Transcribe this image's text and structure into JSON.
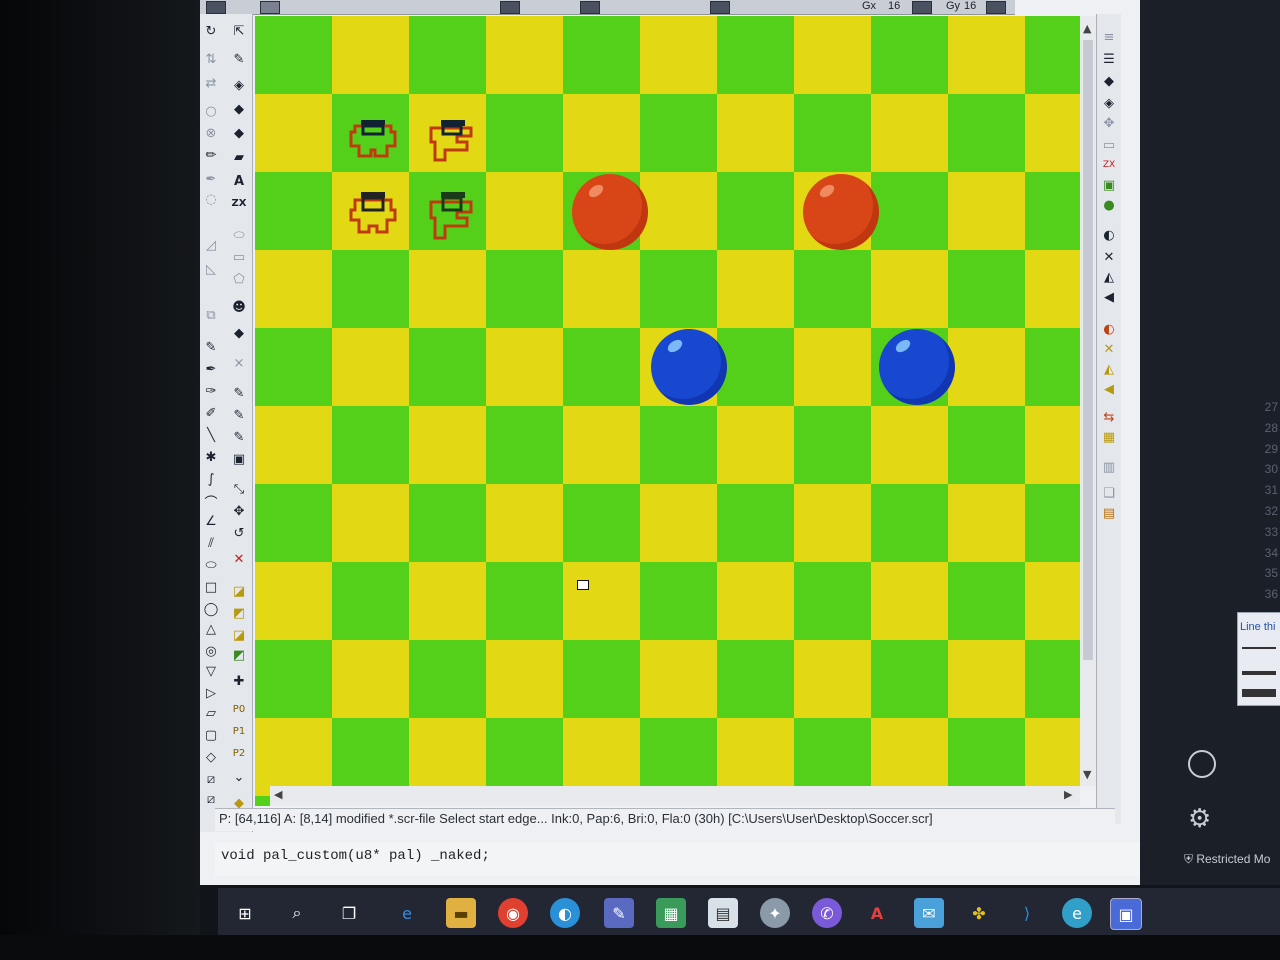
{
  "window": {
    "menubar": {
      "gx_label": "Gx",
      "gx_value": "16",
      "gy_label": "Gy",
      "gy_value": "16"
    }
  },
  "left_toolbar": {
    "text_tool_label": "A",
    "zx_label": "ZX",
    "page_buttons": [
      "P0",
      "P1",
      "P2"
    ]
  },
  "board": {
    "colors": {
      "yellow": "#e2d814",
      "green": "#55d01a",
      "red_ball": "#d84618",
      "blue_ball": "#1848d0"
    }
  },
  "status": {
    "text": "P: [64,116] A: [8,14] modified *.scr-file Select start edge... Ink:0, Pap:6, Bri:0, Fla:0 (30h) [C:\\Users\\User\\Desktop\\Soccer.scr]"
  },
  "code": {
    "line": "void pal_custom(u8* pal) _naked;"
  },
  "editor_gutter": {
    "line_numbers": [
      "27",
      "28",
      "29",
      "30",
      "31",
      "32",
      "33",
      "34",
      "35",
      "36"
    ]
  },
  "side_panel": {
    "title": "Line thi",
    "restricted_label": "Restricted Mo"
  },
  "taskbar": {
    "icons": [
      "windows-start-icon",
      "search-icon",
      "task-view-icon",
      "edge-icon",
      "file-explorer-icon",
      "chrome-icon",
      "edge-new-icon",
      "paint-icon",
      "photos-icon",
      "notepad-icon",
      "pinned-app-icon",
      "viber-icon",
      "acrobat-icon",
      "mail-icon",
      "puzzle-app-icon",
      "vscode-icon",
      "edge-dev-icon",
      "active-app-icon"
    ]
  }
}
